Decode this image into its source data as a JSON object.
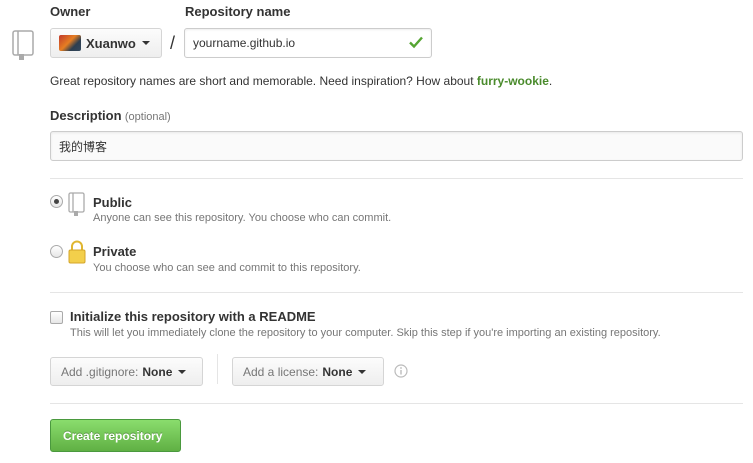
{
  "owner": {
    "label": "Owner",
    "name": "Xuanwo"
  },
  "repo": {
    "label": "Repository name",
    "value": "yourname.github.io",
    "slash": "/"
  },
  "hint": {
    "text": "Great repository names are short and memorable. Need inspiration? How about ",
    "suggestion": "furry-wookie",
    "suffix": "."
  },
  "description": {
    "label": "Description",
    "optional": "(optional)",
    "value": "我的博客"
  },
  "visibility": {
    "public_title": "Public",
    "public_desc": "Anyone can see this repository. You choose who can commit.",
    "private_title": "Private",
    "private_desc": "You choose who can see and commit to this repository.",
    "selected": "public"
  },
  "readme": {
    "title": "Initialize this repository with a README",
    "desc": "This will let you immediately clone the repository to your computer. Skip this step if you're importing an existing repository.",
    "checked": false
  },
  "gitignore": {
    "prefix": "Add .gitignore:",
    "value": "None"
  },
  "license": {
    "prefix": "Add a license:",
    "value": "None"
  },
  "create_button": "Create repository",
  "colors": {
    "accent_green": "#60b044",
    "link_green": "#4a8b2c",
    "check_green": "#55a532"
  },
  "icons": [
    "repo-icon",
    "repo-public-icon",
    "lock-icon",
    "info-icon",
    "checkmark-icon"
  ]
}
